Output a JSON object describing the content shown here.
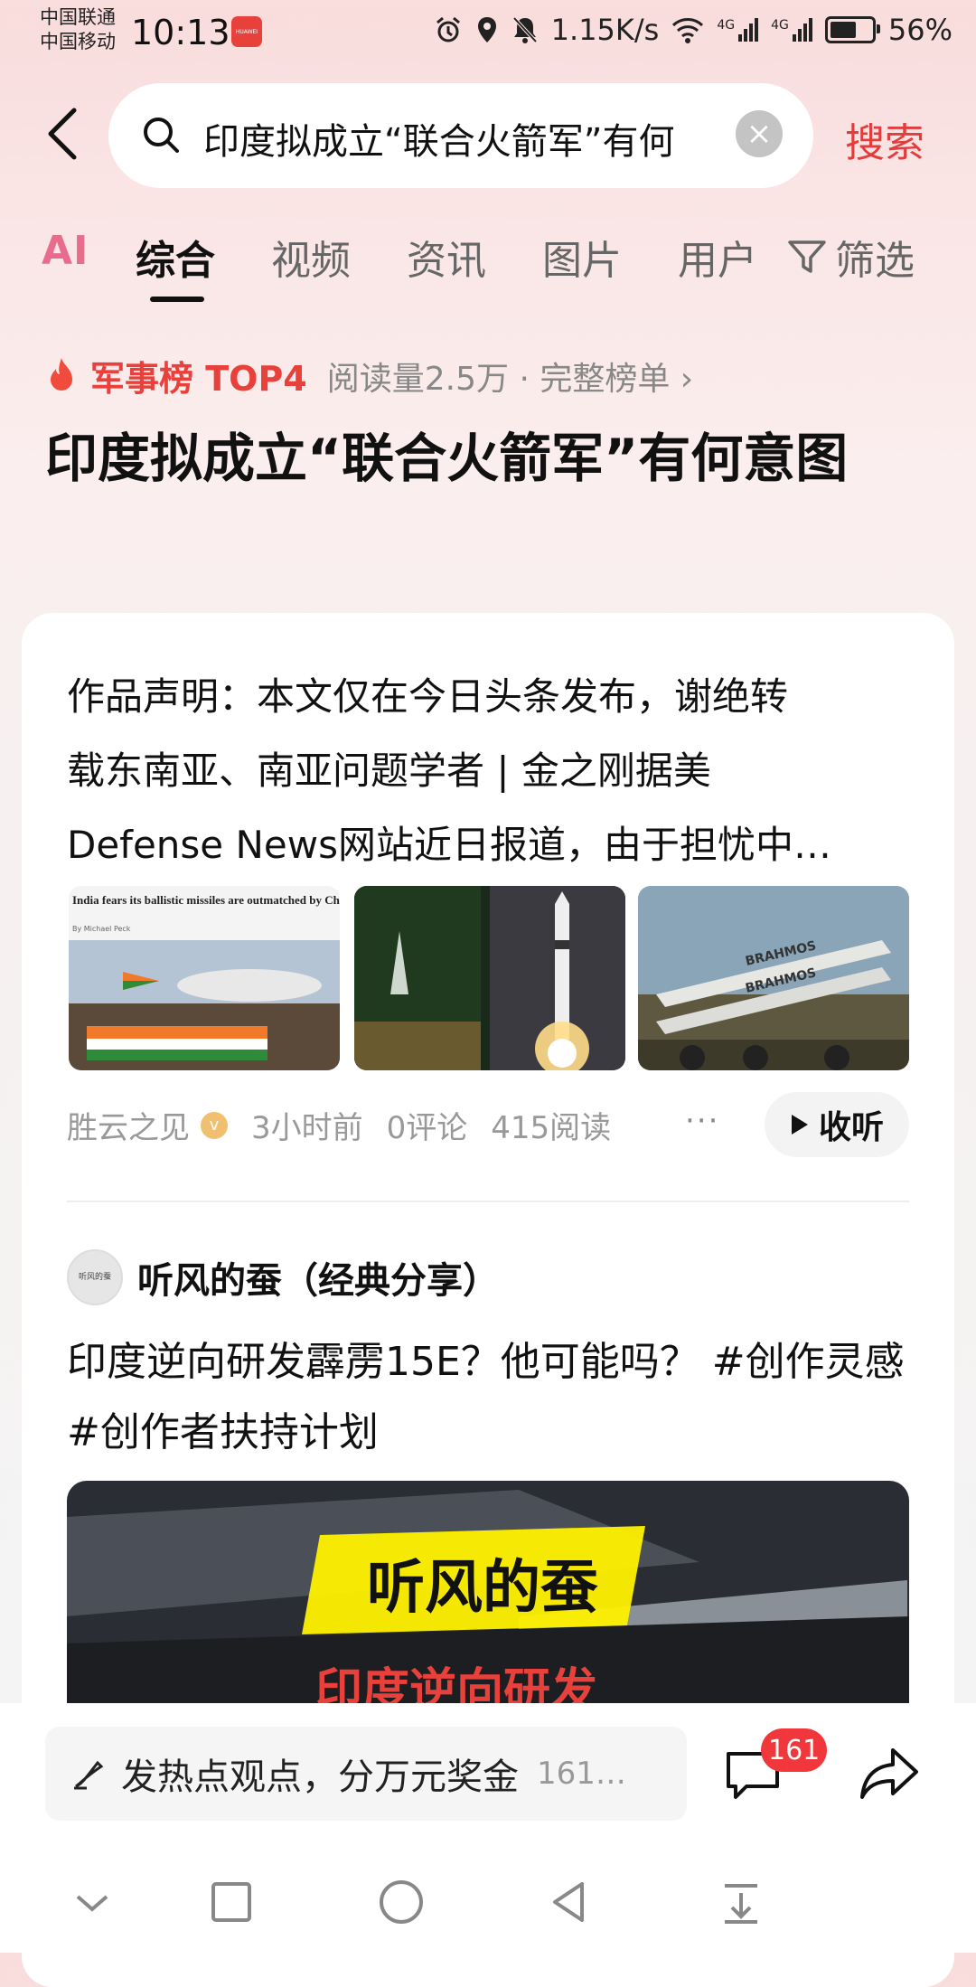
{
  "status_bar": {
    "carrier_1": "中国联通",
    "carrier_2": "中国移动",
    "time": "10:13",
    "app_badge": "HUAWEI",
    "net_speed": "1.15K/s",
    "signal_1": "4G",
    "signal_2": "4G",
    "battery": "56%"
  },
  "search": {
    "query": "印度拟成立“联合火箭军”有何",
    "submit_label": "搜索"
  },
  "tabs": [
    {
      "label": "AI"
    },
    {
      "label": "综合"
    },
    {
      "label": "视频"
    },
    {
      "label": "资讯"
    },
    {
      "label": "图片"
    },
    {
      "label": "用户"
    }
  ],
  "filter_label": "筛选",
  "hot": {
    "label": "军事榜 TOP4",
    "meta": "阅读量2.5万 · 完整榜单 ›",
    "title": "印度拟成立“联合火箭军”有何意图"
  },
  "article": {
    "lines": [
      "作品声明：本文仅在今日头条发布，谢绝转",
      "载东南亚、南亚问题学者 | 金之刚据美",
      "Defense News网站近日报道，由于担忧中…"
    ],
    "image1_headline": "India fears its ballistic missiles are outmatched by China's",
    "image1_byline": "By Michael Peck",
    "image3_label": "BRAHMOS",
    "author": "胜云之见",
    "time_ago": "3小时前",
    "comments": "0评论",
    "reads": "415阅读",
    "more": "···",
    "listen_label": "收听"
  },
  "post2": {
    "avatar_text": "听风的蚕",
    "author": "听风的蚕（经典分享）",
    "text": "印度逆向研发霹雳15E？他可能吗？ #创作灵感 #创作者扶持计划",
    "video_title": "听风的蚕",
    "video_subtitle": "印度逆向研发"
  },
  "comment_bar": {
    "prompt": "发热点观点，分万元奖金",
    "count_hint": "161…",
    "badge": "161"
  },
  "colors": {
    "accent_red": "#e33c3c",
    "badge_red": "#f0383c",
    "ai_pink": "#e86d8c"
  }
}
